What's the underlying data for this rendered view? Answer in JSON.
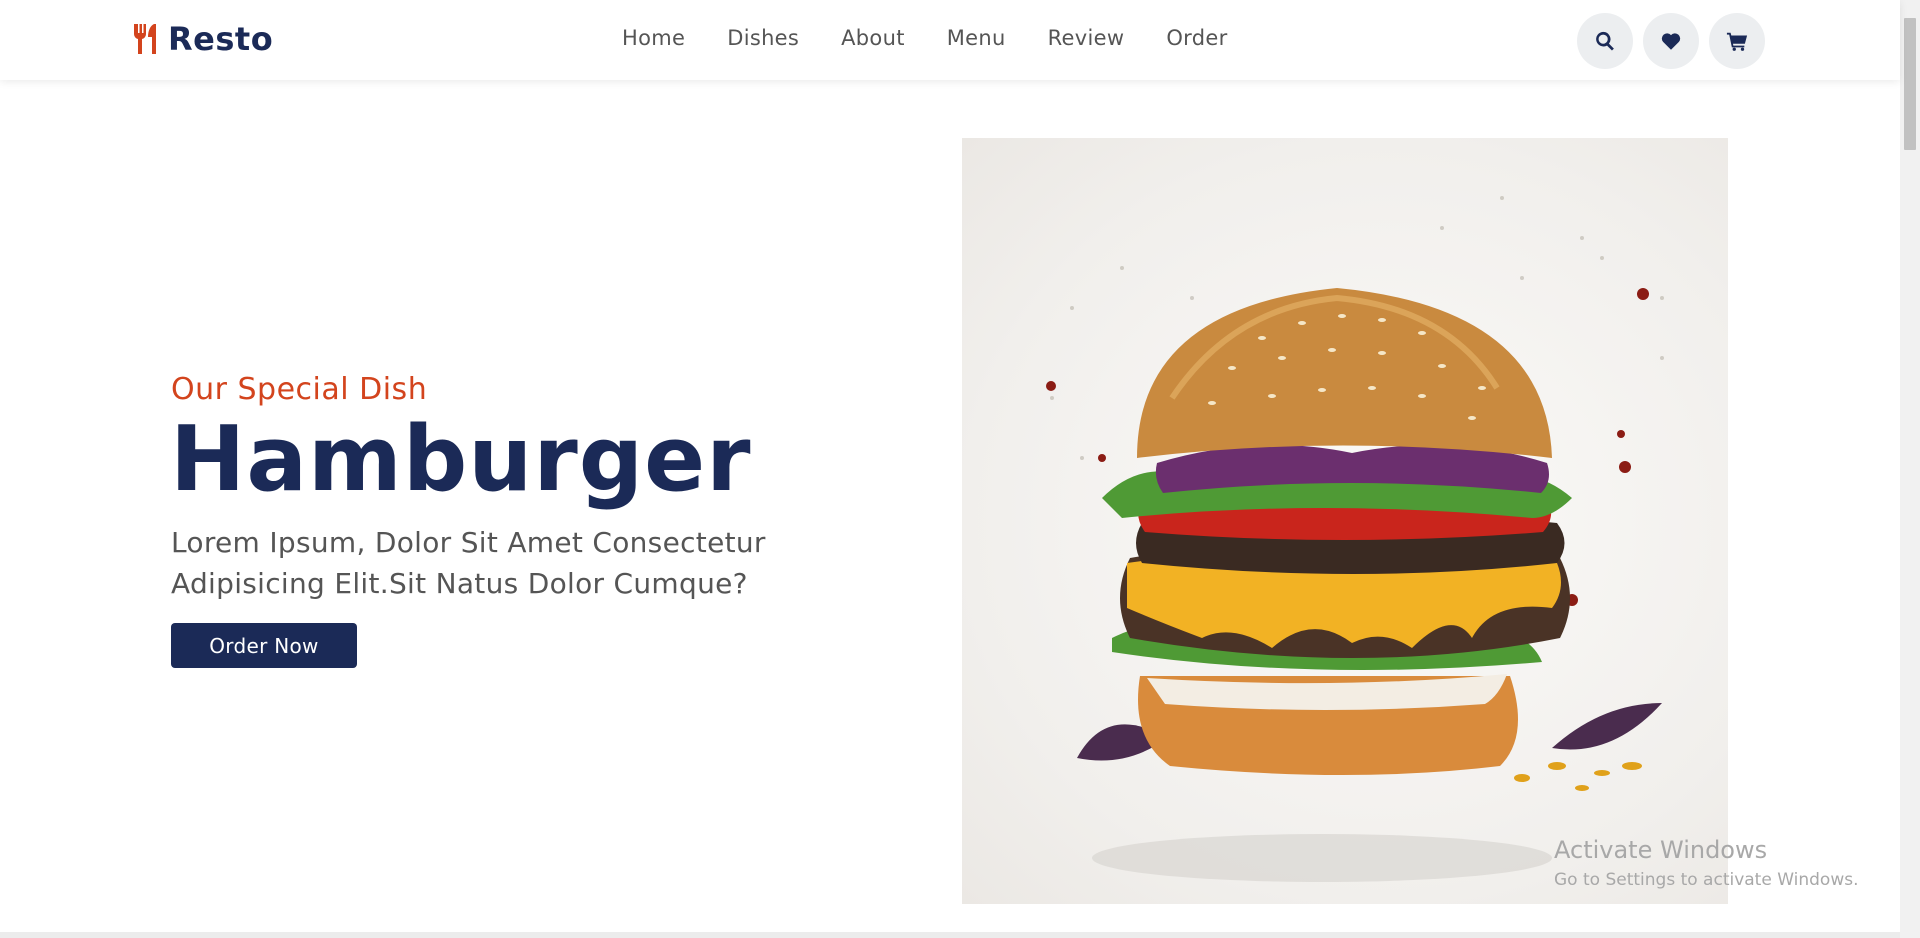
{
  "brand": {
    "name": "Resto",
    "icon": "utensils-icon",
    "accent": "#d3441d",
    "primary": "#1b2a57"
  },
  "nav": {
    "items": [
      {
        "label": "Home"
      },
      {
        "label": "Dishes"
      },
      {
        "label": "About"
      },
      {
        "label": "Menu"
      },
      {
        "label": "Review"
      },
      {
        "label": "Order"
      }
    ]
  },
  "header_icons": [
    "search-icon",
    "heart-icon",
    "cart-icon"
  ],
  "hero": {
    "subtitle": "Our Special Dish",
    "title": "Hamburger",
    "description": "Lorem Ipsum, Dolor Sit Amet Consectetur Adipisicing Elit.Sit Natus Dolor Cumque?",
    "button_label": "Order Now",
    "image": "hamburger-image"
  },
  "watermark": {
    "title": "Activate Windows",
    "subtitle": "Go to Settings to activate Windows."
  }
}
